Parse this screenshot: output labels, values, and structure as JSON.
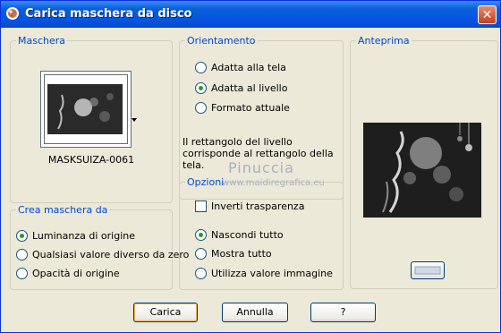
{
  "window": {
    "title": "Carica maschera da disco"
  },
  "groups": {
    "maschera": "Maschera",
    "orientamento": "Orientamento",
    "anteprima": "Anteprima",
    "crea": "Crea maschera da",
    "opzioni": "Opzioni"
  },
  "mask": {
    "name": "MASKSUIZA-0061"
  },
  "orientamento": {
    "options": [
      "Adatta alla tela",
      "Adatta al livello",
      "Formato attuale"
    ],
    "selected": "Adatta al livello",
    "description": "Il rettangolo del livello corrisponde al rettangolo della tela."
  },
  "crea": {
    "options": [
      "Luminanza di origine",
      "Qualsiasi valore diverso da zero",
      "Opacità di origine"
    ],
    "selected": "Luminanza di origine"
  },
  "opzioni": {
    "invert_label": "Inverti trasparenza",
    "invert_checked": false,
    "options": [
      "Nascondi tutto",
      "Mostra tutto",
      "Utilizza valore immagine"
    ],
    "selected": "Nascondi tutto"
  },
  "buttons": {
    "ok": "Carica",
    "cancel": "Annulla",
    "help": "?"
  },
  "watermark": {
    "line1": "Pinuccia",
    "line2": "www.maidiregrafica.eu"
  },
  "colors": {
    "titlebar": "#0554e3",
    "group_legend": "#0046d5",
    "dialog_bg": "#ece9d8"
  }
}
